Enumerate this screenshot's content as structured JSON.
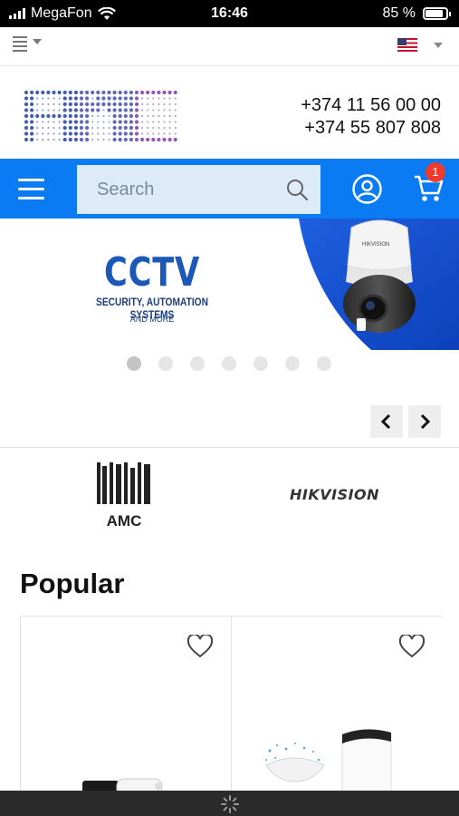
{
  "status_bar": {
    "carrier": "MegaFon",
    "time": "16:46",
    "battery": "85 %"
  },
  "top_bar": {
    "language_flag": "us-flag",
    "menu_icon": "list-icon"
  },
  "header": {
    "phone_1": "+374 11 56 00 00",
    "phone_2": "+374 55 807 808"
  },
  "nav": {
    "search_placeholder": "Search",
    "cart_count": "1"
  },
  "banner": {
    "title": "CCTV",
    "subtitle": "SECURITY, AUTOMATION SYSTEMS",
    "tagline": "AND MORE",
    "camera_brand": "HIKVISION",
    "slides": 7,
    "active_slide": 0
  },
  "brands": {
    "brand_1": "AMC",
    "brand_2": "HIKVISION"
  },
  "popular": {
    "title": "Popular"
  },
  "colors": {
    "accent": "#0a7bf2",
    "badge": "#ee3b2d",
    "banner_blue": "#1b58b8"
  }
}
